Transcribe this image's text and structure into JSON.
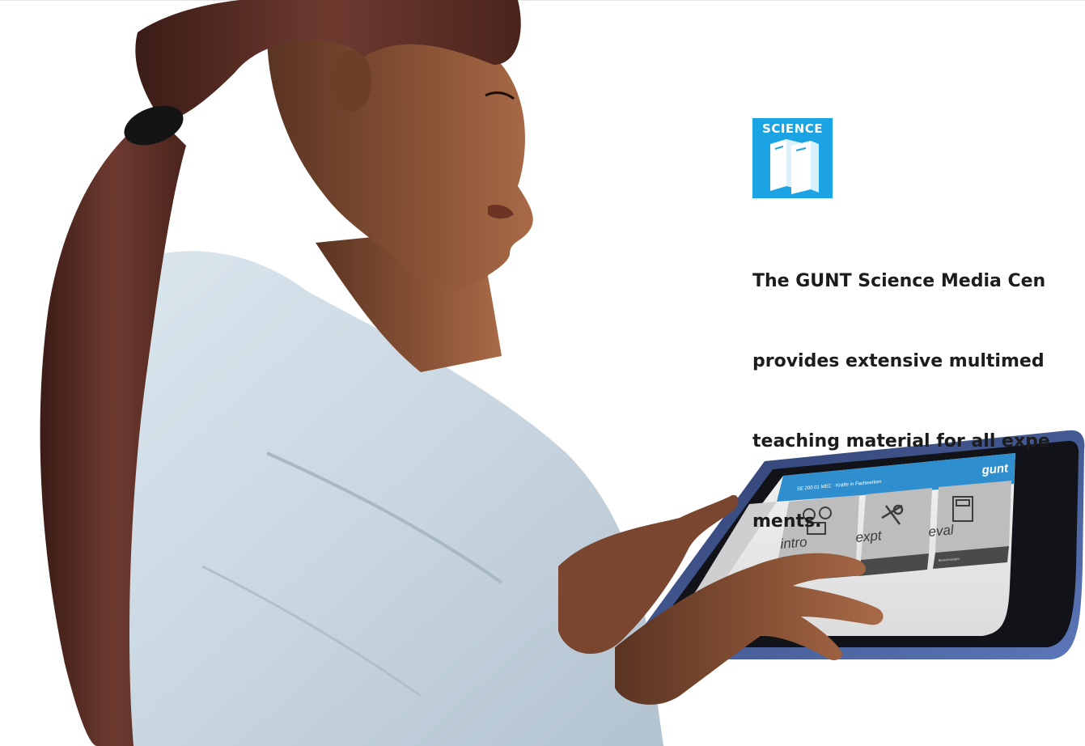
{
  "badge": {
    "label": "SCIENCE",
    "icon": "books-icon",
    "color": "#1ba3e3"
  },
  "caption": {
    "lines": [
      "The GUNT Science Media Cen",
      "provides extensive multimed",
      "teaching material for all expe",
      "ments."
    ]
  },
  "tablet": {
    "header_title": "SE 200.01 MEC · Kräfte in Fachwerken",
    "logo": "gunt",
    "tiles": [
      {
        "word": "intro",
        "icon": "glasses-icon",
        "caption": ""
      },
      {
        "word": "expt",
        "icon": "wrench-icon",
        "caption": ""
      },
      {
        "word": "eval",
        "icon": "calculator-icon",
        "caption": "Berechnungen"
      }
    ],
    "sidebar_icons": [
      "home-icon",
      "document-icon",
      "image-icon",
      "media-icon",
      "graduation-icon"
    ]
  }
}
